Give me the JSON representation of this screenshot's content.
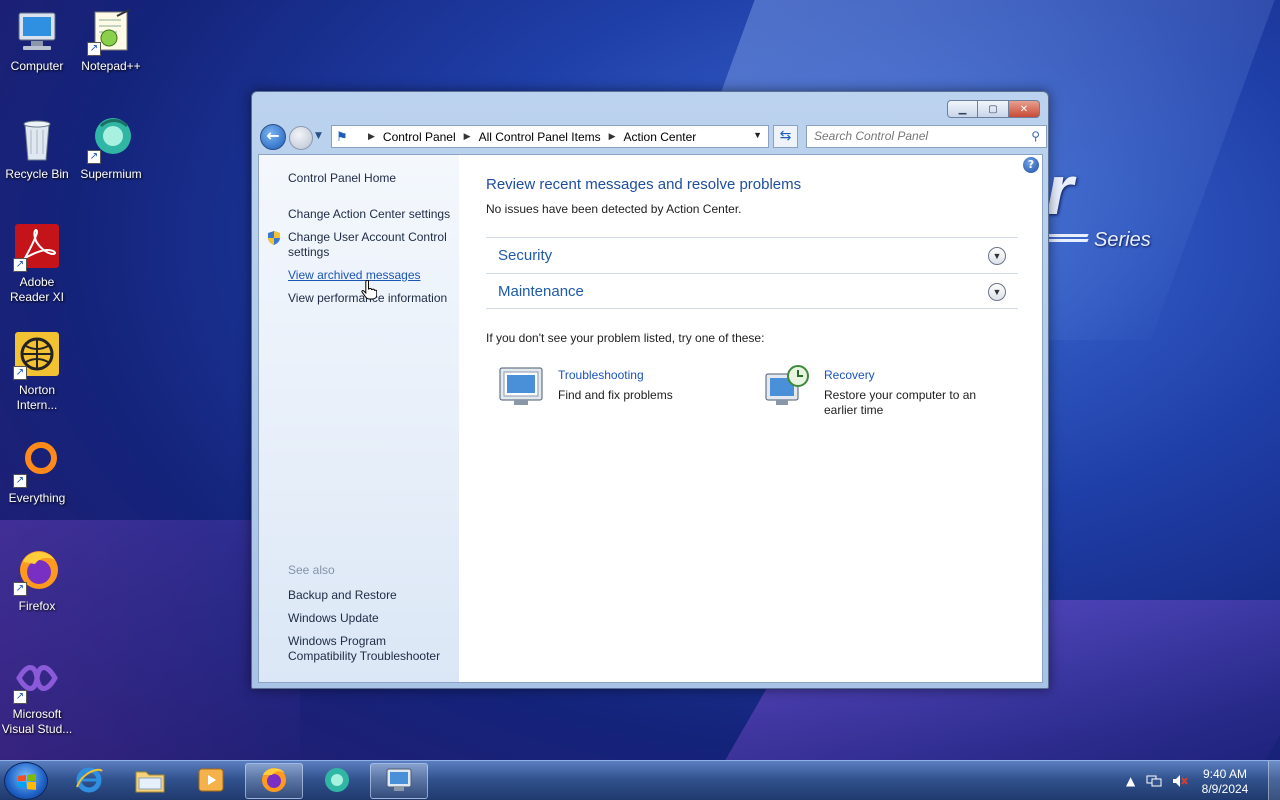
{
  "desktop": {
    "wallpaper_text": "r",
    "wallpaper_series": "Series",
    "icons": [
      {
        "label": "Computer"
      },
      {
        "label": "Notepad++"
      },
      {
        "label": "Recycle Bin"
      },
      {
        "label": "Supermium"
      },
      {
        "label": "Adobe Reader XI"
      },
      {
        "label": "Norton Intern..."
      },
      {
        "label": "Everything"
      },
      {
        "label": "Firefox"
      },
      {
        "label": "Microsoft Visual Stud..."
      }
    ]
  },
  "window": {
    "breadcrumb": [
      "Control Panel",
      "All Control Panel Items",
      "Action Center"
    ],
    "search_placeholder": "Search Control Panel",
    "sidebar": {
      "home": "Control Panel Home",
      "links": [
        "Change Action Center settings",
        "Change User Account Control settings",
        "View archived messages",
        "View performance information"
      ],
      "see_also_heading": "See also",
      "see_also": [
        "Backup and Restore",
        "Windows Update",
        "Windows Program Compatibility Troubleshooter"
      ]
    },
    "main": {
      "title": "Review recent messages and resolve problems",
      "subtitle": "No issues have been detected by Action Center.",
      "sections": [
        "Security",
        "Maintenance"
      ],
      "hint": "If you don't see your problem listed, try one of these:",
      "tiles": [
        {
          "link": "Troubleshooting",
          "desc": "Find and fix problems"
        },
        {
          "link": "Recovery",
          "desc": "Restore your computer to an earlier time"
        }
      ]
    }
  },
  "taskbar": {
    "time": "9:40 AM",
    "date": "8/9/2024"
  },
  "colors": {
    "link": "#1a55b8",
    "title": "#1e4e9e",
    "close_button": "#c84a35"
  }
}
